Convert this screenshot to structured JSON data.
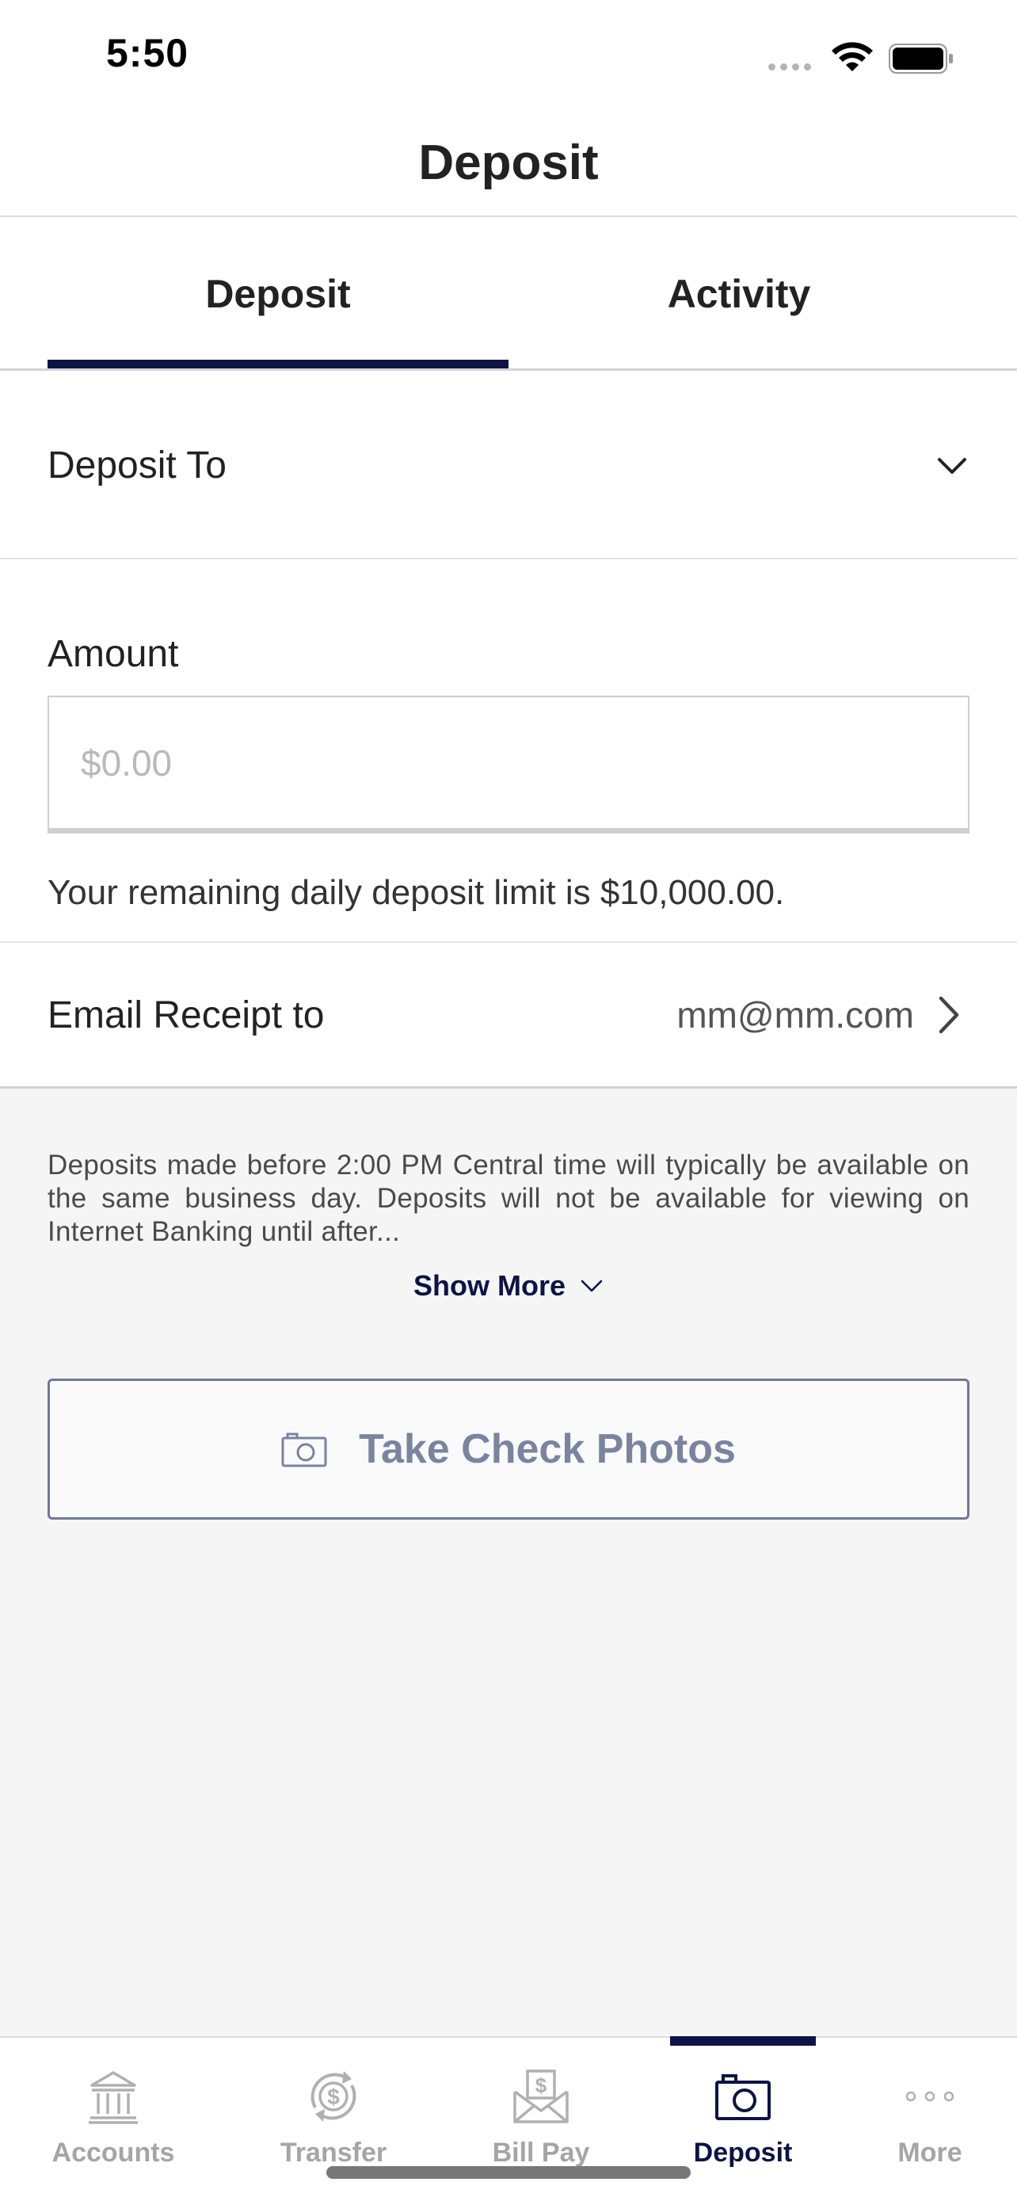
{
  "status_bar": {
    "time": "5:50"
  },
  "header": {
    "title": "Deposit"
  },
  "tabs": [
    {
      "label": "Deposit",
      "active": true
    },
    {
      "label": "Activity",
      "active": false
    }
  ],
  "deposit_to": {
    "label": "Deposit To"
  },
  "amount": {
    "label": "Amount",
    "placeholder": "$0.00",
    "value": ""
  },
  "limit_text": "Your remaining daily deposit limit is $10,000.00.",
  "email_receipt": {
    "label": "Email Receipt to",
    "value": "mm@mm.com"
  },
  "disclaimer": "Deposits made before 2:00 PM Central time will typically be available on the same business day.  Deposits will not be available for viewing on Internet Banking until after...",
  "show_more_label": "Show More",
  "take_photos_label": "Take Check Photos",
  "bottom_nav": {
    "items": [
      {
        "label": "Accounts",
        "icon": "bank-icon"
      },
      {
        "label": "Transfer",
        "icon": "transfer-dollar-icon"
      },
      {
        "label": "Bill Pay",
        "icon": "bill-envelope-icon"
      },
      {
        "label": "Deposit",
        "icon": "camera-icon",
        "active": true
      },
      {
        "label": "More",
        "icon": "more-dots-icon"
      }
    ]
  },
  "colors": {
    "accent": "#0c1445",
    "inactive": "#a5a5a5",
    "button_text": "#7a849f"
  }
}
